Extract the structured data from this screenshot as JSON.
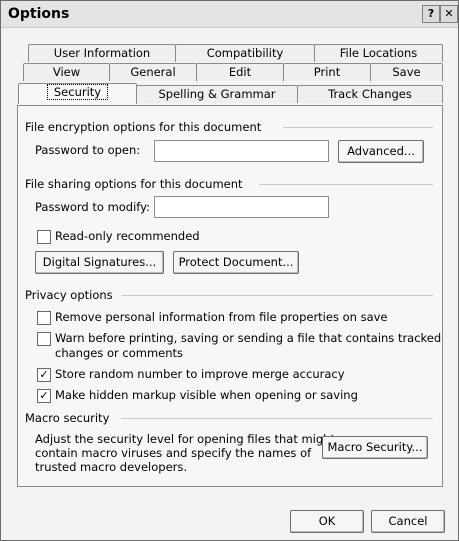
{
  "window": {
    "title": "Options",
    "help_glyph": "?",
    "close_glyph": "✕"
  },
  "tabs": {
    "row1": [
      "User Information",
      "Compatibility",
      "File Locations"
    ],
    "row2": [
      "View",
      "General",
      "Edit",
      "Print",
      "Save"
    ],
    "row3": [
      "Security",
      "Spelling & Grammar",
      "Track Changes"
    ],
    "active": "Security"
  },
  "encryption": {
    "heading": "File encryption options for this document",
    "password_open_label": "Password to open:",
    "password_open_value": "",
    "advanced_button": "Advanced..."
  },
  "sharing": {
    "heading": "File sharing options for this document",
    "password_modify_label": "Password to modify:",
    "password_modify_value": "",
    "readonly_label": "Read-only recommended",
    "readonly_checked": false,
    "digital_signatures_button": "Digital Signatures...",
    "protect_document_button": "Protect Document..."
  },
  "privacy": {
    "heading": "Privacy options",
    "options": [
      {
        "line1": "Remove personal information from file properties on save",
        "line2": "",
        "checked": false
      },
      {
        "line1": "Warn before printing, saving or sending a file that contains tracked",
        "line2": "changes or comments",
        "checked": false
      },
      {
        "line1": "Store random number to improve merge accuracy",
        "line2": "",
        "checked": true
      },
      {
        "line1": "Make hidden markup visible when opening or saving",
        "line2": "",
        "checked": true
      }
    ]
  },
  "macro": {
    "heading": "Macro security",
    "desc_lines": [
      "Adjust the security level for opening files that might",
      "contain macro viruses and specify the names of",
      "trusted macro developers."
    ],
    "button": "Macro Security..."
  },
  "footer": {
    "ok": "OK",
    "cancel": "Cancel"
  }
}
